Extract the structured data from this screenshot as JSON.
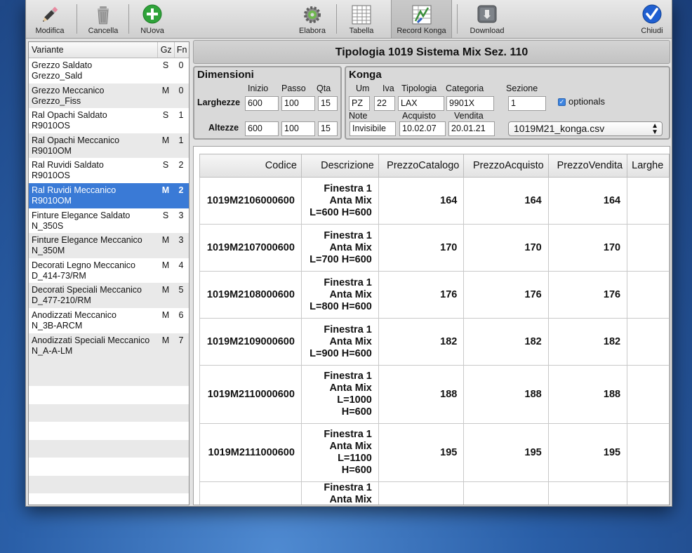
{
  "toolbar": {
    "buttons": [
      {
        "label": "Modifica",
        "icon": "pencil-icon"
      },
      {
        "label": "Cancella",
        "icon": "trash-icon"
      },
      {
        "label": "NUova",
        "icon": "plus-icon"
      },
      {
        "label": "Elabora",
        "icon": "gear-icon"
      },
      {
        "label": "Tabella",
        "icon": "table-icon"
      },
      {
        "label": "Record Konga",
        "icon": "record-icon"
      },
      {
        "label": "Download",
        "icon": "download-icon"
      },
      {
        "label": "Chiudi",
        "icon": "checkmark-icon"
      }
    ]
  },
  "variants": {
    "headers": {
      "name": "Variante",
      "gz": "Gz",
      "fn": "Fn"
    },
    "rows": [
      {
        "line1": "Grezzo Saldato",
        "line2": "Grezzo_Sald",
        "gz": "S",
        "fn": "0"
      },
      {
        "line1": "Grezzo Meccanico",
        "line2": "Grezzo_Fiss",
        "gz": "M",
        "fn": "0"
      },
      {
        "line1": "Ral Opachi Saldato",
        "line2": "R9010OS",
        "gz": "S",
        "fn": "1"
      },
      {
        "line1": "Ral Opachi Meccanico",
        "line2": "R9010OM",
        "gz": "M",
        "fn": "1"
      },
      {
        "line1": "Ral Ruvidi Saldato",
        "line2": "R9010OS",
        "gz": "S",
        "fn": "2"
      },
      {
        "line1": "Ral Ruvidi Meccanico",
        "line2": "R9010OM",
        "gz": "M",
        "fn": "2"
      },
      {
        "line1": "Finture Elegance Saldato",
        "line2": "N_350S",
        "gz": "S",
        "fn": "3"
      },
      {
        "line1": "Finture Elegance Meccanico",
        "line2": "N_350M",
        "gz": "M",
        "fn": "3"
      },
      {
        "line1": "Decorati Legno Meccanico",
        "line2": "D_414-73/RM",
        "gz": "M",
        "fn": "4"
      },
      {
        "line1": "Decorati Speciali Meccanico",
        "line2": "D_477-210/RM",
        "gz": "M",
        "fn": "5"
      },
      {
        "line1": "Anodizzati Meccanico",
        "line2": "N_3B-ARCM",
        "gz": "M",
        "fn": "6"
      },
      {
        "line1": "Anodizzati Speciali Meccanico",
        "line2": "N_A-A-LM",
        "gz": "M",
        "fn": "7"
      }
    ],
    "selected_index": 5
  },
  "title": "Tipologia 1019 Sistema Mix Sez. 110",
  "dimensioni": {
    "title": "Dimensioni",
    "col_inizio": "Inizio",
    "col_passo": "Passo",
    "col_qta": "Qta",
    "larghezze_label": "Larghezze",
    "larghezze": {
      "inizio": "600",
      "passo": "100",
      "qta": "15"
    },
    "altezze_label": "Altezze",
    "altezze": {
      "inizio": "600",
      "passo": "100",
      "qta": "15"
    }
  },
  "konga": {
    "title": "Konga",
    "um_label": "Um",
    "um": "PZ",
    "iva_label": "Iva",
    "iva": "22",
    "tipologia_label": "Tipologia",
    "tipologia": "LAX",
    "categoria_label": "Categoria",
    "categoria": "9901X",
    "sezione_label": "Sezione",
    "sezione": "1",
    "optionals_label": "optionals",
    "optionals_checked": true,
    "note_label": "Note",
    "note": "Invisibile",
    "acquisto_label": "Acquisto",
    "acquisto": "10.02.07",
    "vendita_label": "Vendita",
    "vendita": "20.01.21",
    "file_select": "1019M21_konga.csv"
  },
  "grid": {
    "columns": [
      "Codice",
      "Descrizione",
      "PrezzoCatalogo",
      "PrezzoAcquisto",
      "PrezzoVendita",
      "Larghe"
    ],
    "rows": [
      {
        "codice": "1019M2106000600",
        "descrizione": "Finestra 1 Anta Mix L=600 H=600",
        "catalogo": "164",
        "acquisto": "164",
        "vendita": "164"
      },
      {
        "codice": "1019M2107000600",
        "descrizione": "Finestra 1 Anta Mix L=700 H=600",
        "catalogo": "170",
        "acquisto": "170",
        "vendita": "170"
      },
      {
        "codice": "1019M2108000600",
        "descrizione": "Finestra 1 Anta Mix L=800 H=600",
        "catalogo": "176",
        "acquisto": "176",
        "vendita": "176"
      },
      {
        "codice": "1019M2109000600",
        "descrizione": "Finestra 1 Anta Mix L=900 H=600",
        "catalogo": "182",
        "acquisto": "182",
        "vendita": "182"
      },
      {
        "codice": "1019M2110000600",
        "descrizione": "Finestra 1 Anta Mix L=1000 H=600",
        "catalogo": "188",
        "acquisto": "188",
        "vendita": "188"
      },
      {
        "codice": "1019M2111000600",
        "descrizione": "Finestra 1 Anta Mix L=1100 H=600",
        "catalogo": "195",
        "acquisto": "195",
        "vendita": "195"
      },
      {
        "codice": "",
        "descrizione": "Finestra 1 Anta Mix",
        "catalogo": "",
        "acquisto": "",
        "vendita": ""
      }
    ]
  },
  "colors": {
    "selection": "#3a7ad6",
    "checkmark_blue": "#1f5fd1",
    "add_green": "#2fa33a"
  }
}
